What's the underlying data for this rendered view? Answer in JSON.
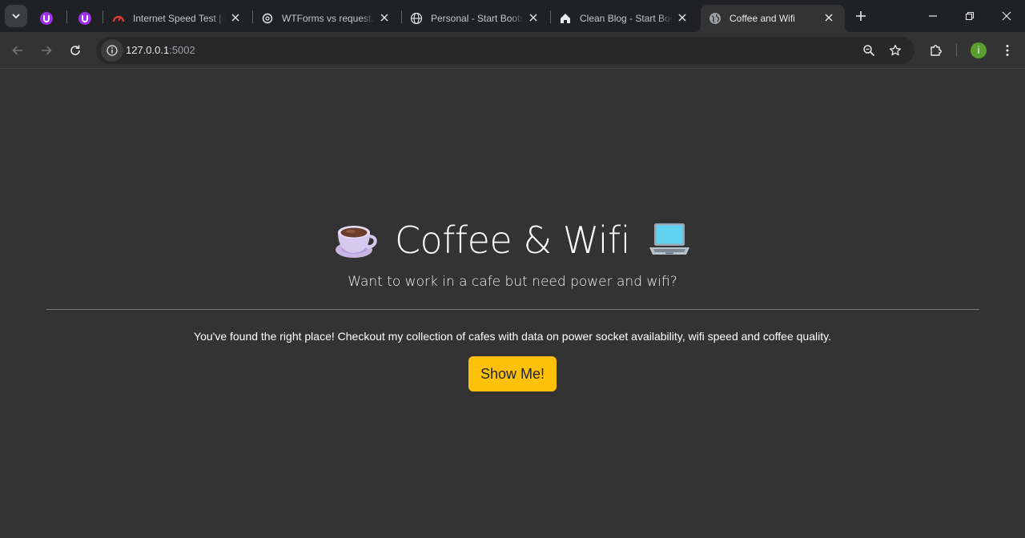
{
  "browser": {
    "tabs": [
      {
        "title": "",
        "favicon": "purple-u-extension-icon",
        "active": false
      },
      {
        "title": "",
        "favicon": "purple-u-extension-icon",
        "active": false
      },
      {
        "title": "Internet Speed Test | Fast.com",
        "favicon": "speedometer-icon",
        "active": false
      },
      {
        "title": "WTForms vs request.form",
        "favicon": "openai-icon",
        "active": false
      },
      {
        "title": "Personal - Start Bootstrap",
        "favicon": "globe-icon",
        "active": false
      },
      {
        "title": "Clean Blog - Start Bootstrap",
        "favicon": "home-icon",
        "active": false
      },
      {
        "title": "Coffee and Wifi",
        "favicon": "globe-icon",
        "active": true
      }
    ],
    "address": {
      "host": "127.0.0.1",
      "port": ":5002"
    },
    "profile_initial": "i",
    "accent": "#5a9e2d"
  },
  "page": {
    "title": "Coffee & Wifi",
    "title_left_icon": "coffee-cup-icon",
    "title_right_icon": "laptop-icon",
    "subtitle": "Want to work in a cafe but need power and wifi?",
    "lead": "You've found the right place! Checkout my collection of cafes with data on power socket availability, wifi speed and coffee quality.",
    "cta_label": "Show Me!",
    "cta_color": "#ffc107",
    "background": "#333333"
  }
}
